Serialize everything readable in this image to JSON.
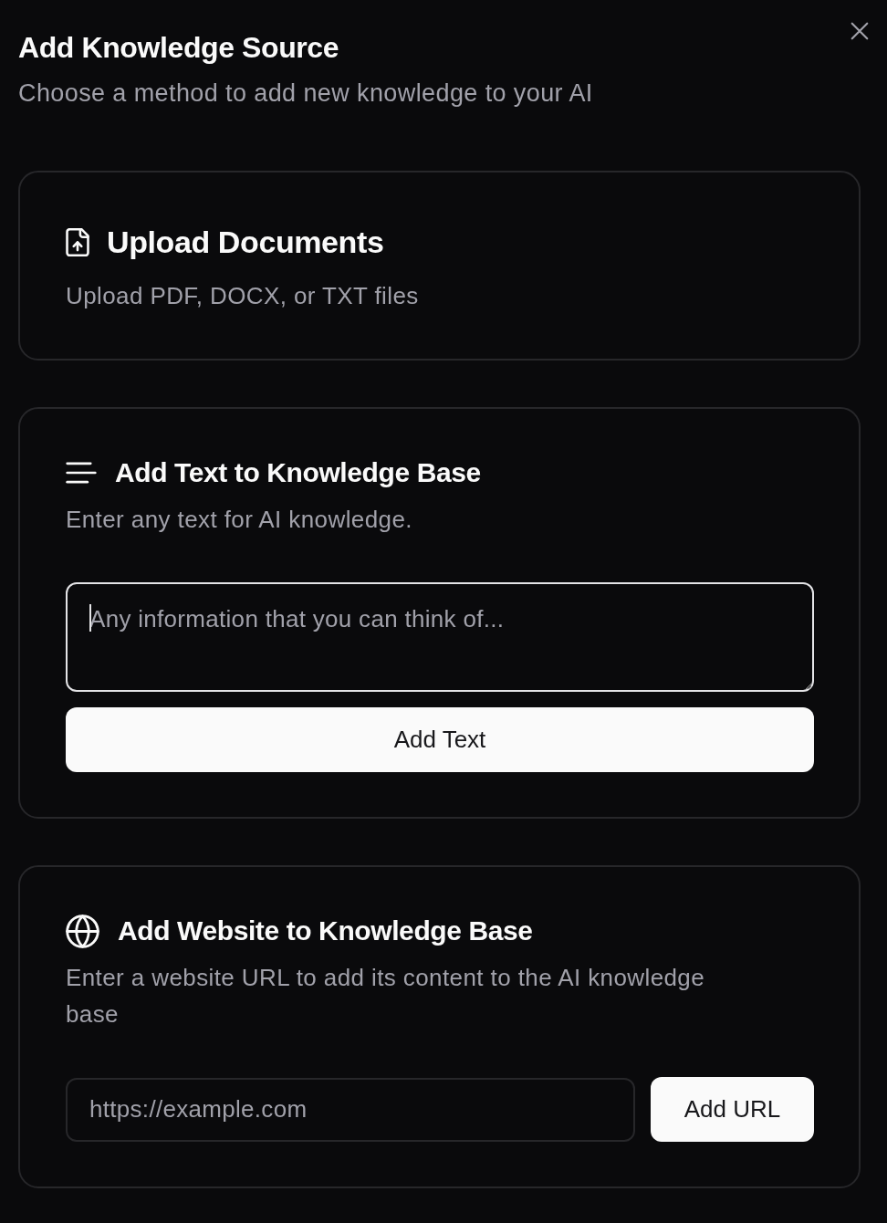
{
  "dialog": {
    "title": "Add Knowledge Source",
    "subtitle": "Choose a method to add new knowledge to your AI"
  },
  "sections": [
    {
      "kind": "upload",
      "title": "Upload Documents",
      "description": "Upload PDF, DOCX, or TXT files"
    },
    {
      "kind": "text",
      "title": "Add Text to Knowledge Base",
      "description": "Enter any text for AI knowledge.",
      "textarea": {
        "placeholder": "Any information that you can think of...",
        "focused": true
      },
      "button": {
        "label": "Add Text"
      }
    },
    {
      "kind": "website",
      "title": "Add Website to Knowledge Base",
      "description": "Enter a website URL to add its content to the AI knowledge base",
      "input": {
        "placeholder": "https://example.com"
      },
      "button": {
        "label": "Add URL"
      }
    }
  ]
}
